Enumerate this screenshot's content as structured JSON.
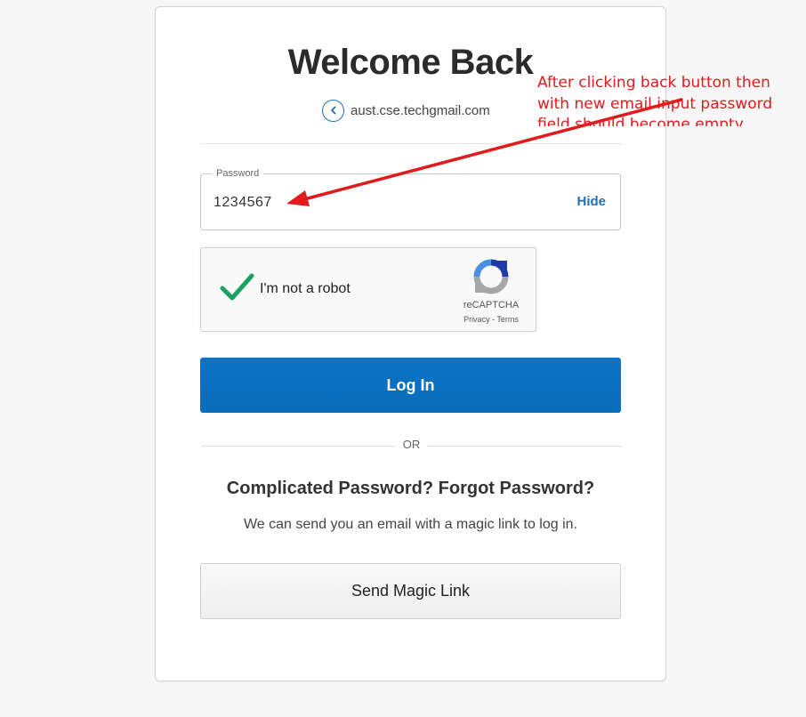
{
  "page": {
    "title": "Welcome Back",
    "account_email": "aust.cse.techgmail.com"
  },
  "password_field": {
    "label": "Password",
    "value": "1234567",
    "toggle_label": "Hide"
  },
  "recaptcha": {
    "label": "I'm not a robot",
    "checked": true,
    "brand": "reCAPTCHA",
    "privacy_label": "Privacy",
    "separator": " - ",
    "terms_label": "Terms"
  },
  "login_button": {
    "label": "Log In"
  },
  "divider": {
    "label": "OR"
  },
  "forgot": {
    "title": "Complicated Password? Forgot Password?",
    "description": "We can send you an email with a magic link to log in."
  },
  "magic_link_button": {
    "label": "Send Magic Link"
  },
  "annotation": {
    "lines": [
      "After clicking back button then",
      "with new email input password",
      "field should become empty"
    ],
    "color": "#e01b1b"
  },
  "colors": {
    "primary": "#0b74c6",
    "link": "#1e6fb5",
    "check": "#1aa260"
  }
}
